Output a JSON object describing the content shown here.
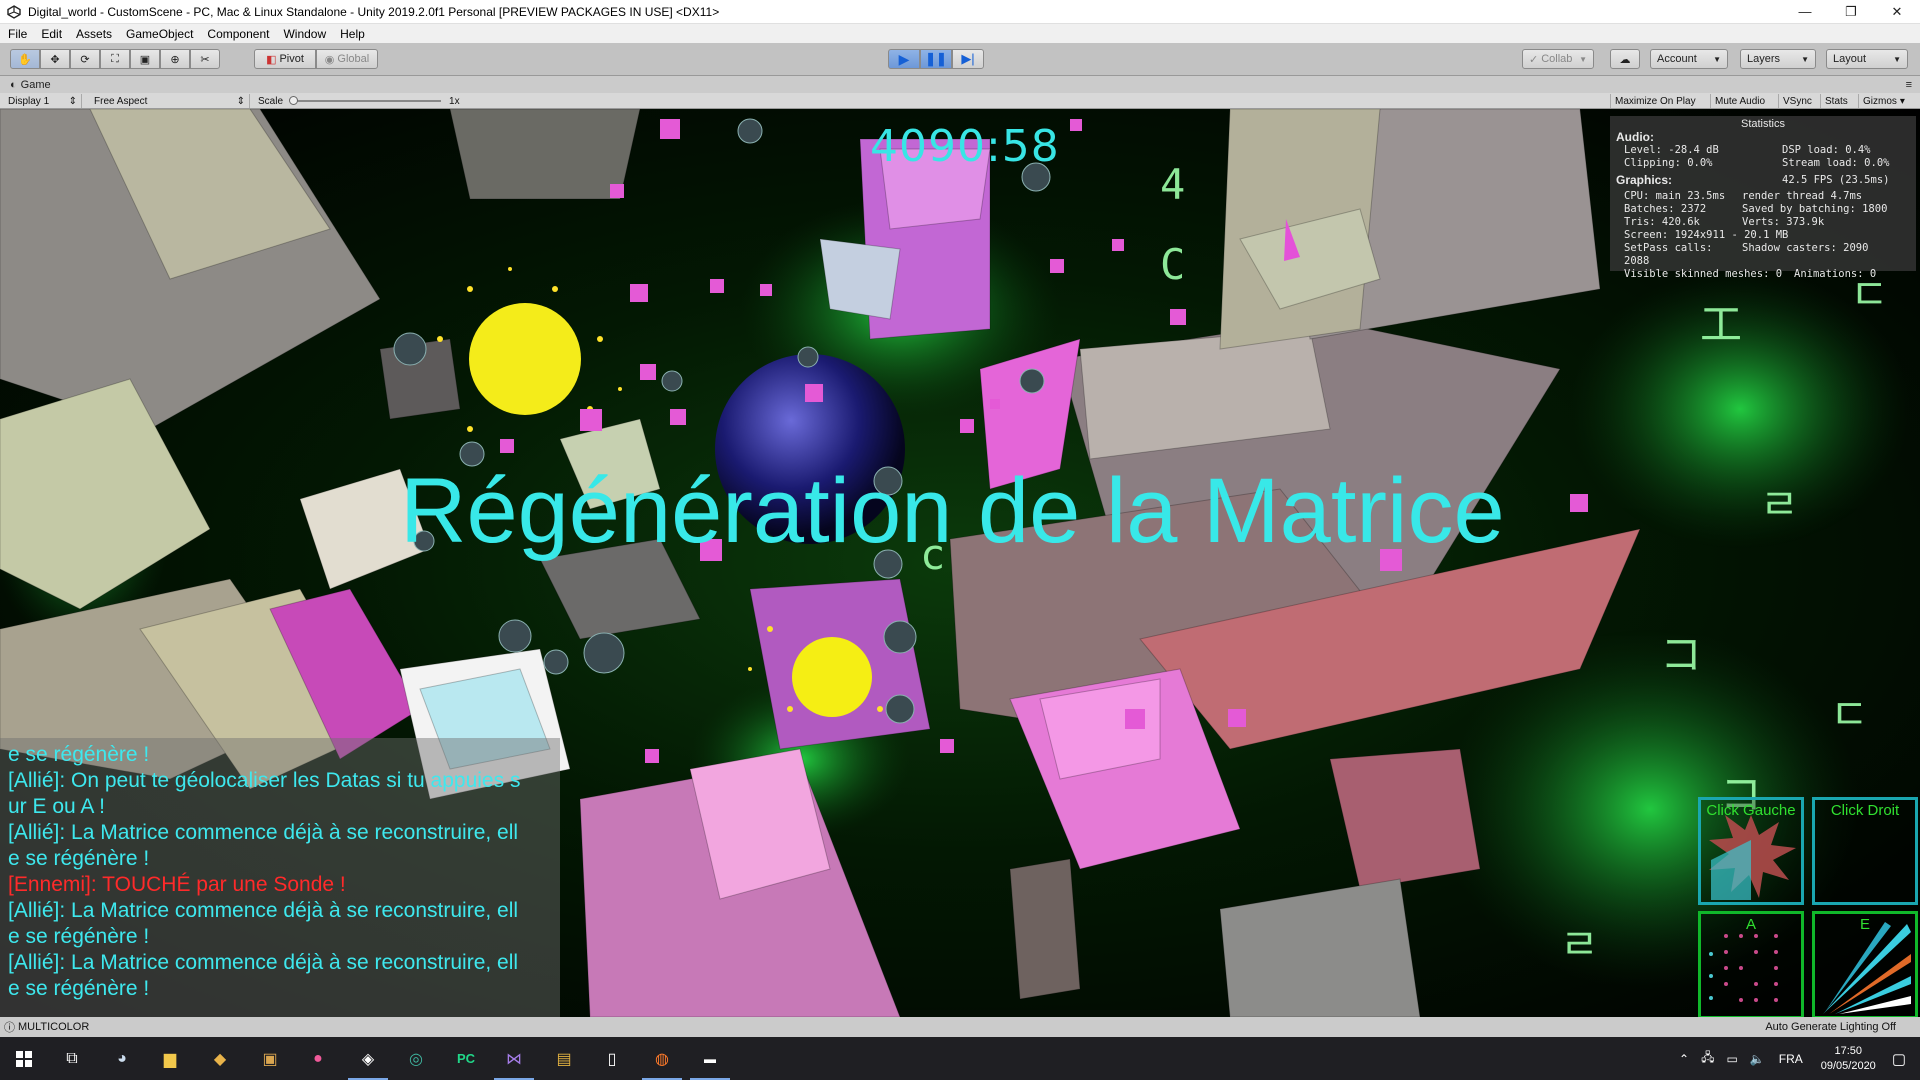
{
  "window": {
    "title": "Digital_world - CustomScene - PC, Mac & Linux Standalone - Unity 2019.2.0f1 Personal [PREVIEW PACKAGES IN USE] <DX11>",
    "minimize": "—",
    "maximize": "❐",
    "close": "✕"
  },
  "menu": [
    "File",
    "Edit",
    "Assets",
    "GameObject",
    "Component",
    "Window",
    "Help"
  ],
  "toolbar": {
    "pivot": "Pivot",
    "global": "Global",
    "collab": "Collab",
    "account": "Account",
    "layers": "Layers",
    "layout": "Layout"
  },
  "game_tab": {
    "label": "Game",
    "display": "Display 1",
    "aspect": "Free Aspect",
    "scale_label": "Scale",
    "scale_value": "1x",
    "maximize_on_play": "Maximize On Play",
    "mute_audio": "Mute Audio",
    "vsync": "VSync",
    "stats": "Stats",
    "gizmos": "Gizmos"
  },
  "hud": {
    "timer": "4090:58",
    "banner": "Régénération de la Matrice"
  },
  "statistics": {
    "title": "Statistics",
    "audio_label": "Audio:",
    "level": "Level: -28.4 dB",
    "dsp": "DSP load: 0.4%",
    "clipping": "Clipping: 0.0%",
    "stream": "Stream load: 0.0%",
    "graphics_label": "Graphics:",
    "fps": "42.5 FPS (23.5ms)",
    "cpu": "CPU: main 23.5ms",
    "render_thread": "render thread 4.7ms",
    "batches": "Batches: 2372",
    "saved_batching": "Saved by batching: 1800",
    "tris": "Tris: 420.6k",
    "verts": "Verts: 373.9k",
    "screen": "Screen: 1924x911 - 20.1 MB",
    "setpass": "SetPass calls: 2088",
    "shadow": "Shadow casters: 2090",
    "skinned": "Visible skinned meshes: 0",
    "animations": "Animations: 0"
  },
  "chat": [
    {
      "type": "ally",
      "text": "e se régénère !"
    },
    {
      "type": "ally",
      "text": "[Allié]: On peut te géolocaliser les Datas si tu appuies s"
    },
    {
      "type": "ally",
      "text": "ur E ou A !"
    },
    {
      "type": "ally",
      "text": "[Allié]: La Matrice commence déjà à se reconstruire, ell"
    },
    {
      "type": "ally",
      "text": "e se régénère !"
    },
    {
      "type": "enemy",
      "text": "[Ennemi]: TOUCHÉ par une Sonde !"
    },
    {
      "type": "ally",
      "text": "[Allié]: La Matrice commence déjà à se reconstruire, ell"
    },
    {
      "type": "ally",
      "text": "e se régénère !"
    },
    {
      "type": "ally",
      "text": "[Allié]: La Matrice commence déjà à se reconstruire, ell"
    },
    {
      "type": "ally",
      "text": "e se régénère !"
    }
  ],
  "skills": {
    "left_click": "Click Gauche",
    "right_click": "Click Droit",
    "a": "A",
    "e": "E"
  },
  "status": {
    "left": "MULTICOLOR",
    "right": "Auto Generate Lighting Off"
  },
  "taskbar": {
    "lang": "FRA",
    "time": "17:50",
    "date": "09/05/2020"
  },
  "colors": {
    "cyan_text": "#38e8e8",
    "enemy_red": "#ff2a2a",
    "skill_cyan": "#1aa7b0",
    "skill_green": "#10b82a"
  }
}
